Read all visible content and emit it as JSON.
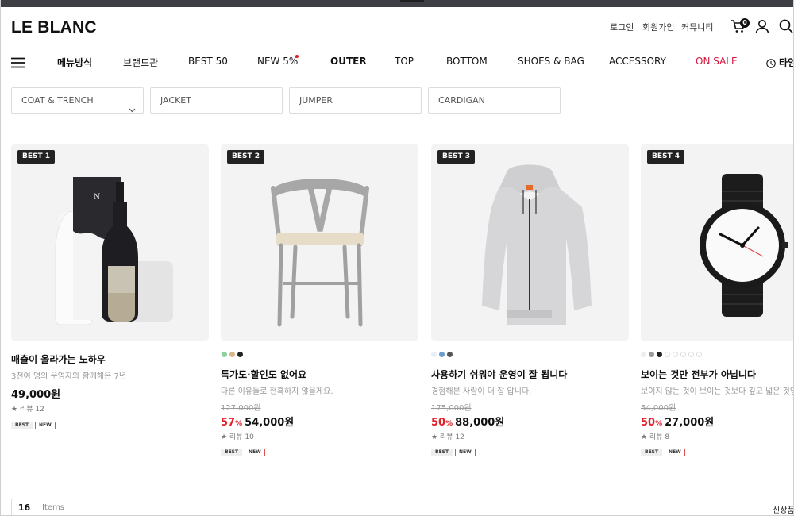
{
  "header": {
    "logo": "LE BLANC",
    "util_links": [
      "로그인",
      "회원가입",
      "커뮤니티"
    ],
    "cart_count": "0",
    "icons": [
      "cart-icon",
      "user-icon",
      "search-icon"
    ]
  },
  "nav": {
    "menu_icon": "hamburger-icon",
    "items": [
      "메뉴방식",
      "브랜드관",
      "BEST 50",
      "NEW 5%",
      "OUTER",
      "TOP",
      "BOTTOM",
      "SHOES & BAG",
      "ACCESSORY",
      "ON SALE",
      "타임"
    ],
    "sale_color": "#d4163c",
    "timer_icon": "clock-icon"
  },
  "filters": {
    "dropdown_value": "COAT & TRENCH",
    "chips": [
      "JACKET",
      "JUMPER",
      "CARDIGAN"
    ]
  },
  "products": [
    {
      "badge": "BEST 1",
      "image": "wine-bottle-gift-box",
      "title": "매출이 올라가는 노하우",
      "desc": "3천여 명의 운영자와 함께해온 7년",
      "price": "49,000원",
      "review": "★ 리뷰 12",
      "tags": [
        "BEST",
        "NEW"
      ]
    },
    {
      "badge": "BEST 2",
      "image": "wishbone-chair",
      "swatches": [
        "#8fd0a0",
        "#d6b88a",
        "#222222"
      ],
      "title": "특가도·할인도 없어요",
      "desc": "다른 이유들로 현혹하지 않을게요.",
      "original_price": "127,000원",
      "discount": "57",
      "discount_unit": "%",
      "price": "54,000원",
      "review": "★ 리뷰 10",
      "tags": [
        "BEST",
        "NEW"
      ]
    },
    {
      "badge": "BEST 3",
      "image": "grey-hoodie",
      "swatches": [
        "#e8eef6",
        "#6d9cd0",
        "#555555"
      ],
      "title": "사용하기 쉬워야 운영이 잘 됩니다",
      "desc": "경험해본 사람이 더 잘 압니다.",
      "original_price": "175,000원",
      "discount": "50",
      "discount_unit": "%",
      "price": "88,000원",
      "review": "★ 리뷰 12",
      "tags": [
        "BEST",
        "NEW"
      ]
    },
    {
      "badge": "BEST 4",
      "image": "nato-strap-watch",
      "swatches": [
        "#eeeeee",
        "#999999",
        "#222222",
        "empty",
        "empty",
        "empty",
        "empty",
        "empty"
      ],
      "title": "보이는 것만 전부가 아닙니다",
      "desc": "보이지 않는 것이 보이는 것보다 깊고 넓은 것입니",
      "original_price": "54,000원",
      "discount": "50",
      "discount_unit": "%",
      "price": "27,000원",
      "review": "★ 리뷰 8",
      "tags": [
        "BEST",
        "NEW"
      ]
    }
  ],
  "footer": {
    "count": "16",
    "items_label": "Items",
    "sort_label": "신상품"
  }
}
